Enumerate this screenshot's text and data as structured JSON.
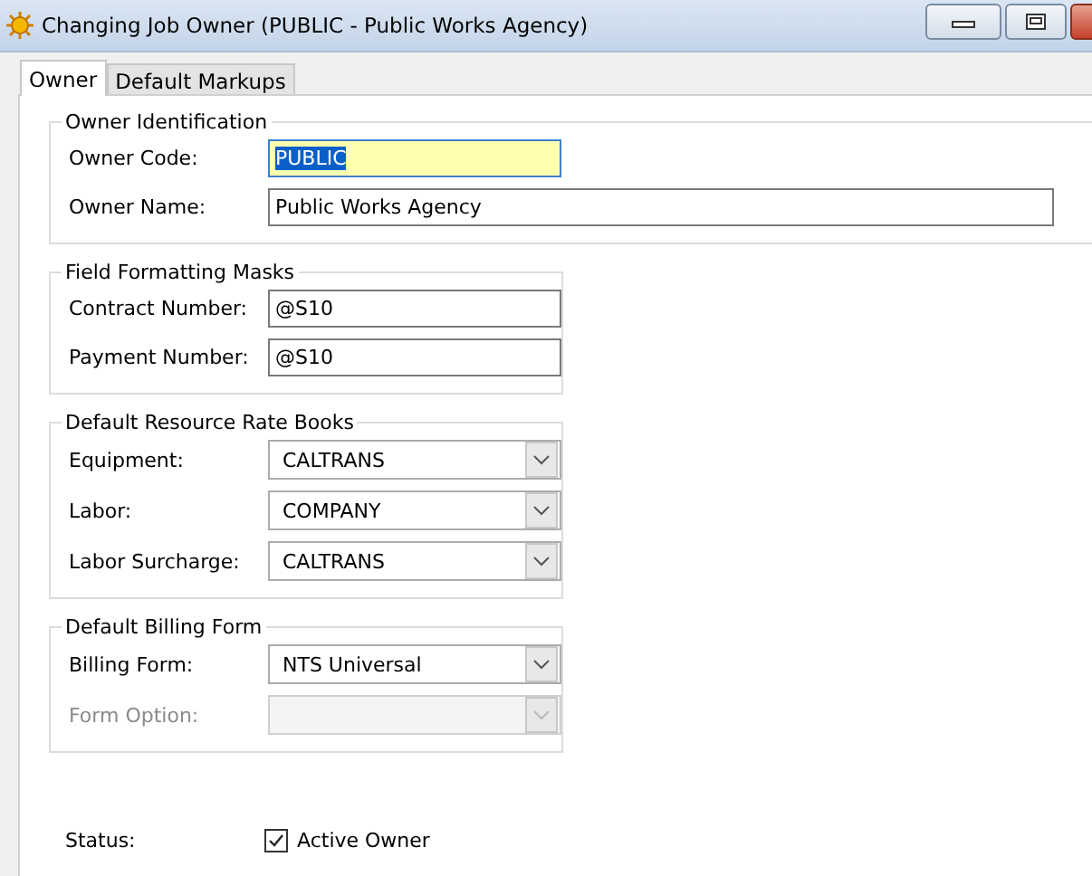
{
  "window": {
    "title": "Changing Job Owner  (PUBLIC - Public Works Agency)"
  },
  "tabs": [
    {
      "label": "Owner",
      "selected": true
    },
    {
      "label": "Default Markups",
      "selected": false
    }
  ],
  "groups": [
    {
      "title": "Owner Identification",
      "wide": true,
      "fields": [
        {
          "kind": "text",
          "label": "Owner Code:",
          "value": "PUBLIC",
          "focused": true,
          "wide": false
        },
        {
          "kind": "text",
          "label": "Owner Name:",
          "value": "Public Works Agency",
          "focused": false,
          "wide": true
        }
      ]
    },
    {
      "title": "Field Formatting Masks",
      "wide": false,
      "fields": [
        {
          "kind": "text",
          "label": "Contract Number:",
          "value": "@S10",
          "focused": false,
          "wide": false
        },
        {
          "kind": "text",
          "label": "Payment Number:",
          "value": "@S10",
          "focused": false,
          "wide": false
        }
      ]
    },
    {
      "title": "Default Resource Rate Books",
      "wide": false,
      "fields": [
        {
          "kind": "dropdown",
          "label": "Equipment:",
          "value": "CALTRANS",
          "disabled": false
        },
        {
          "kind": "dropdown",
          "label": "Labor:",
          "value": "COMPANY",
          "disabled": false
        },
        {
          "kind": "dropdown",
          "label": "Labor Surcharge:",
          "value": "CALTRANS",
          "disabled": false
        }
      ]
    },
    {
      "title": "Default Billing Form",
      "wide": false,
      "fields": [
        {
          "kind": "dropdown",
          "label": "Billing Form:",
          "value": "NTS Universal",
          "disabled": false
        },
        {
          "kind": "dropdown",
          "label": "Form Option:",
          "disabled": true
        }
      ]
    }
  ],
  "status": {
    "label": "Status:",
    "checkbox": {
      "label": "Active Owner",
      "checked": true
    }
  }
}
